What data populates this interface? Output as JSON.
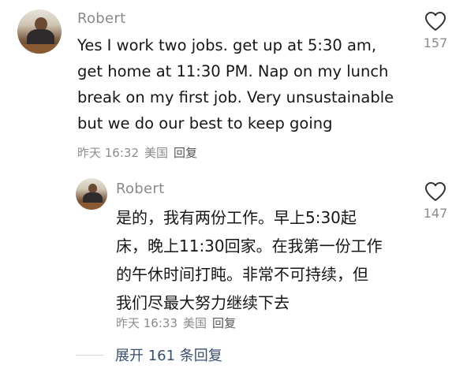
{
  "comment": {
    "author": "Robert",
    "text": "Yes I work two jobs. get up at 5:30 am,\nget home at 11:30 PM. Nap on my lunch\nbreak on my first job. Very unsustainable\nbut we do our best to keep going",
    "time": "昨天 16:32",
    "location": "美国",
    "reply_label": "回复",
    "likes": "157"
  },
  "reply": {
    "author": "Robert",
    "text": "是的，我有两份工作。早上5:30起\n床，晚上11:30回家。在我第一份工作\n的午休时间打盹。非常不可持续，但\n我们尽最大努力继续下去",
    "time": "昨天 16:33",
    "location": "美国",
    "reply_label": "回复",
    "likes": "147"
  },
  "expand": {
    "label": "展开 161 条回复"
  },
  "icons": {
    "like": "heart-outline-icon",
    "avatar": "user-avatar-photo"
  },
  "colors": {
    "link": "#3a4e6e",
    "muted": "#8a8a8a",
    "text": "#161616"
  }
}
